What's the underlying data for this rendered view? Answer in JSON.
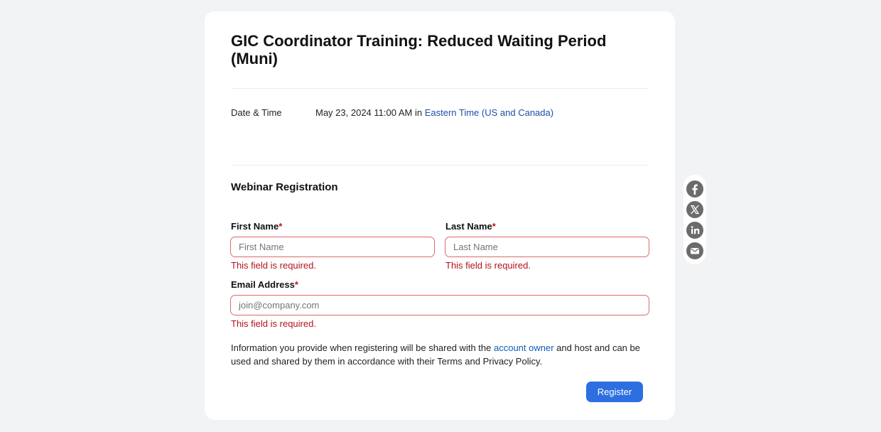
{
  "event": {
    "title": "GIC Coordinator Training: Reduced Waiting Period (Muni)",
    "date_time_label": "Date & Time",
    "date_time_value": "May 23, 2024 11:00 AM in",
    "timezone_link": "Eastern Time (US and Canada)"
  },
  "registration": {
    "heading": "Webinar Registration",
    "first_name": {
      "label": "First Name",
      "required_mark": "*",
      "placeholder": "First Name",
      "value": "",
      "error": "This field is required."
    },
    "last_name": {
      "label": "Last Name",
      "required_mark": "*",
      "placeholder": "Last Name",
      "value": "",
      "error": "This field is required."
    },
    "email": {
      "label": "Email Address",
      "required_mark": "*",
      "placeholder": "join@company.com",
      "value": "",
      "error": "This field is required."
    },
    "notice_before": "Information you provide when registering will be shared with the ",
    "notice_link": "account owner",
    "notice_after": " and host and can be used and shared by them in accordance with their Terms and Privacy Policy.",
    "submit_label": "Register"
  },
  "share": {
    "icons": [
      "facebook-icon",
      "x-icon",
      "linkedin-icon",
      "email-icon"
    ]
  },
  "colors": {
    "background": "#f2f3f5",
    "card": "#ffffff",
    "accent_button": "#2d6fe0",
    "link": "#1d4fa8",
    "error": "#b3121a",
    "required": "#c4141b",
    "error_border": "#d96a6a"
  }
}
